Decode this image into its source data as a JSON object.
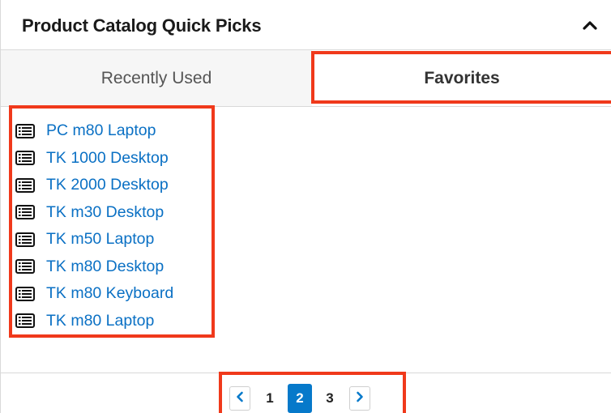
{
  "header": {
    "title": "Product Catalog Quick Picks",
    "collapse_icon": "chevron-up-icon"
  },
  "tabs": [
    {
      "label": "Recently Used",
      "active": false
    },
    {
      "label": "Favorites",
      "active": true
    }
  ],
  "favorites": {
    "item_icon": "list-icon",
    "items": [
      {
        "label": "PC m80 Laptop"
      },
      {
        "label": "TK 1000 Desktop"
      },
      {
        "label": "TK 2000 Desktop"
      },
      {
        "label": "TK m30 Desktop"
      },
      {
        "label": "TK m50 Laptop"
      },
      {
        "label": "TK m80 Desktop"
      },
      {
        "label": "TK m80 Keyboard"
      },
      {
        "label": "TK m80 Laptop"
      }
    ]
  },
  "pagination": {
    "prev_icon": "chevron-left-icon",
    "next_icon": "chevron-right-icon",
    "pages": [
      "1",
      "2",
      "3"
    ],
    "current": "2"
  },
  "colors": {
    "link": "#0a70c4",
    "active_page": "#0679ca",
    "highlight": "#f0391b",
    "tab_inactive_bg": "#f6f6f6"
  }
}
